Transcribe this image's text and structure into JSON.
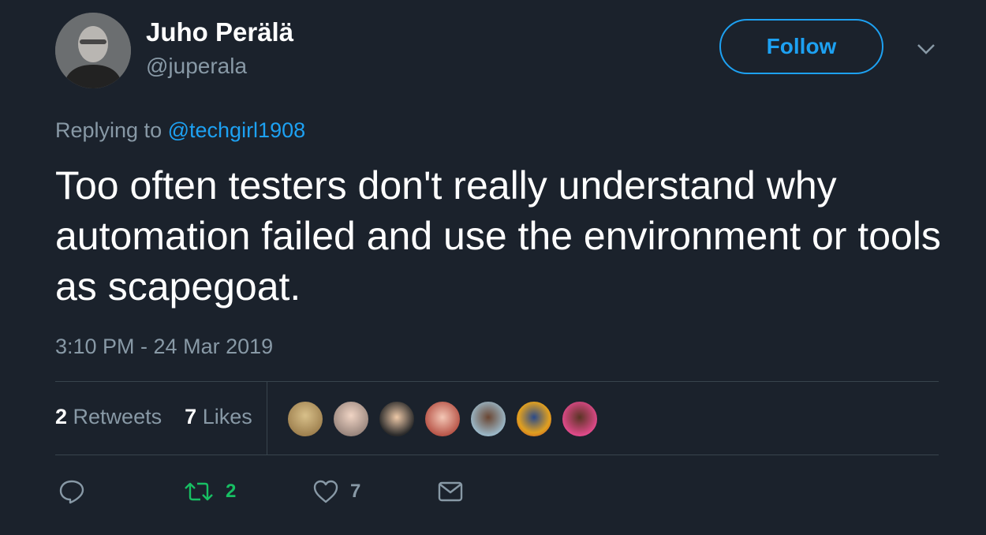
{
  "author": {
    "name": "Juho Perälä",
    "handle": "@juperala"
  },
  "follow_label": "Follow",
  "reply": {
    "prefix": "Replying to",
    "mention": "@techgirl1908"
  },
  "tweet_text": "Too often testers don't really understand why automation failed and use the environment or tools as scapegoat.",
  "timestamp": "3:10 PM - 24 Mar 2019",
  "stats": {
    "retweets_count": "2",
    "retweets_label": "Retweets",
    "likes_count": "7",
    "likes_label": "Likes"
  },
  "actions": {
    "retweet_count": "2",
    "like_count": "7"
  },
  "colors": {
    "background": "#1b222c",
    "accent": "#1da1f2",
    "retweet_green": "#17bf63",
    "muted": "#8899a6"
  },
  "icons": [
    "reply-icon",
    "retweet-icon",
    "heart-icon",
    "message-icon",
    "chevron-down-icon"
  ]
}
